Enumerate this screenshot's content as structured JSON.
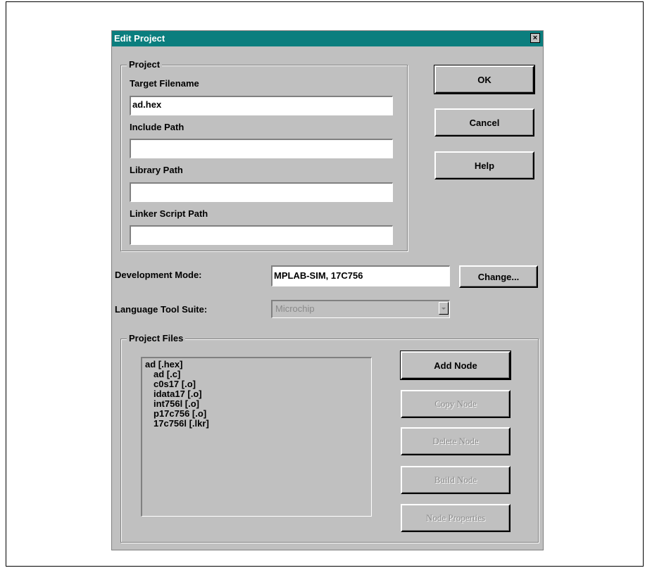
{
  "dialog": {
    "title": "Edit Project",
    "close_glyph": "×"
  },
  "project_group": {
    "label": "Project",
    "target_filename": {
      "label": "Target Filename",
      "value": "ad.hex"
    },
    "include_path": {
      "label": "Include Path",
      "value": ""
    },
    "library_path": {
      "label": "Library Path",
      "value": ""
    },
    "linker_script_path": {
      "label": "Linker Script Path",
      "value": ""
    }
  },
  "buttons": {
    "ok": "OK",
    "cancel": "Cancel",
    "help": "Help",
    "change": "Change..."
  },
  "development_mode": {
    "label": "Development Mode:",
    "value": "MPLAB-SIM, 17C756"
  },
  "language_tool_suite": {
    "label": "Language Tool Suite:",
    "value": "Microchip"
  },
  "project_files": {
    "label": "Project Files",
    "tree": [
      {
        "label": "ad [.hex]",
        "child": false
      },
      {
        "label": "ad [.c]",
        "child": true
      },
      {
        "label": "c0s17 [.o]",
        "child": true
      },
      {
        "label": "idata17 [.o]",
        "child": true
      },
      {
        "label": "int756l [.o]",
        "child": true
      },
      {
        "label": "p17c756 [.o]",
        "child": true
      },
      {
        "label": "17c756l [.lkr]",
        "child": true
      }
    ],
    "add_node": "Add Node",
    "copy_node": "Copy Node",
    "delete_node": "Delete Node",
    "build_node": "Build Node",
    "node_properties": "Node Properties"
  },
  "colors": {
    "titlebar": "#0b7e7e",
    "dialog_face": "#c0c0c0",
    "disabled_text": "#8a8a8a"
  }
}
